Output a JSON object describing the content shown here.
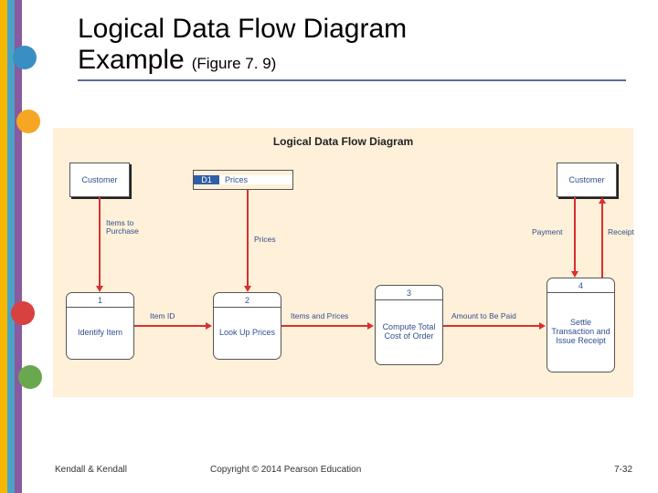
{
  "title": {
    "line1": "Logical Data Flow Diagram",
    "line2": "Example",
    "sub": "(Figure 7. 9)"
  },
  "panel": {
    "title": "Logical Data Flow Diagram"
  },
  "entities": {
    "customerLeft": "Customer",
    "customerRight": "Customer"
  },
  "datastore": {
    "num": "D1",
    "label": "Prices"
  },
  "processes": [
    {
      "num": "1",
      "label": "Identify Item"
    },
    {
      "num": "2",
      "label": "Look Up Prices"
    },
    {
      "num": "3",
      "label": "Compute Total Cost of Order"
    },
    {
      "num": "4",
      "label": "Settle Transaction and Issue Receipt"
    }
  ],
  "flows": {
    "itemsToPurchase": "Items to Purchase",
    "prices": "Prices",
    "payment": "Payment",
    "receipt": "Receipt",
    "itemId": "Item ID",
    "itemsAndPrices": "Items and Prices",
    "amountToBePaid": "Amount to Be Paid"
  },
  "footer": {
    "left": "Kendall & Kendall",
    "mid": "Copyright © 2014 Pearson Education",
    "right": "7-32"
  }
}
